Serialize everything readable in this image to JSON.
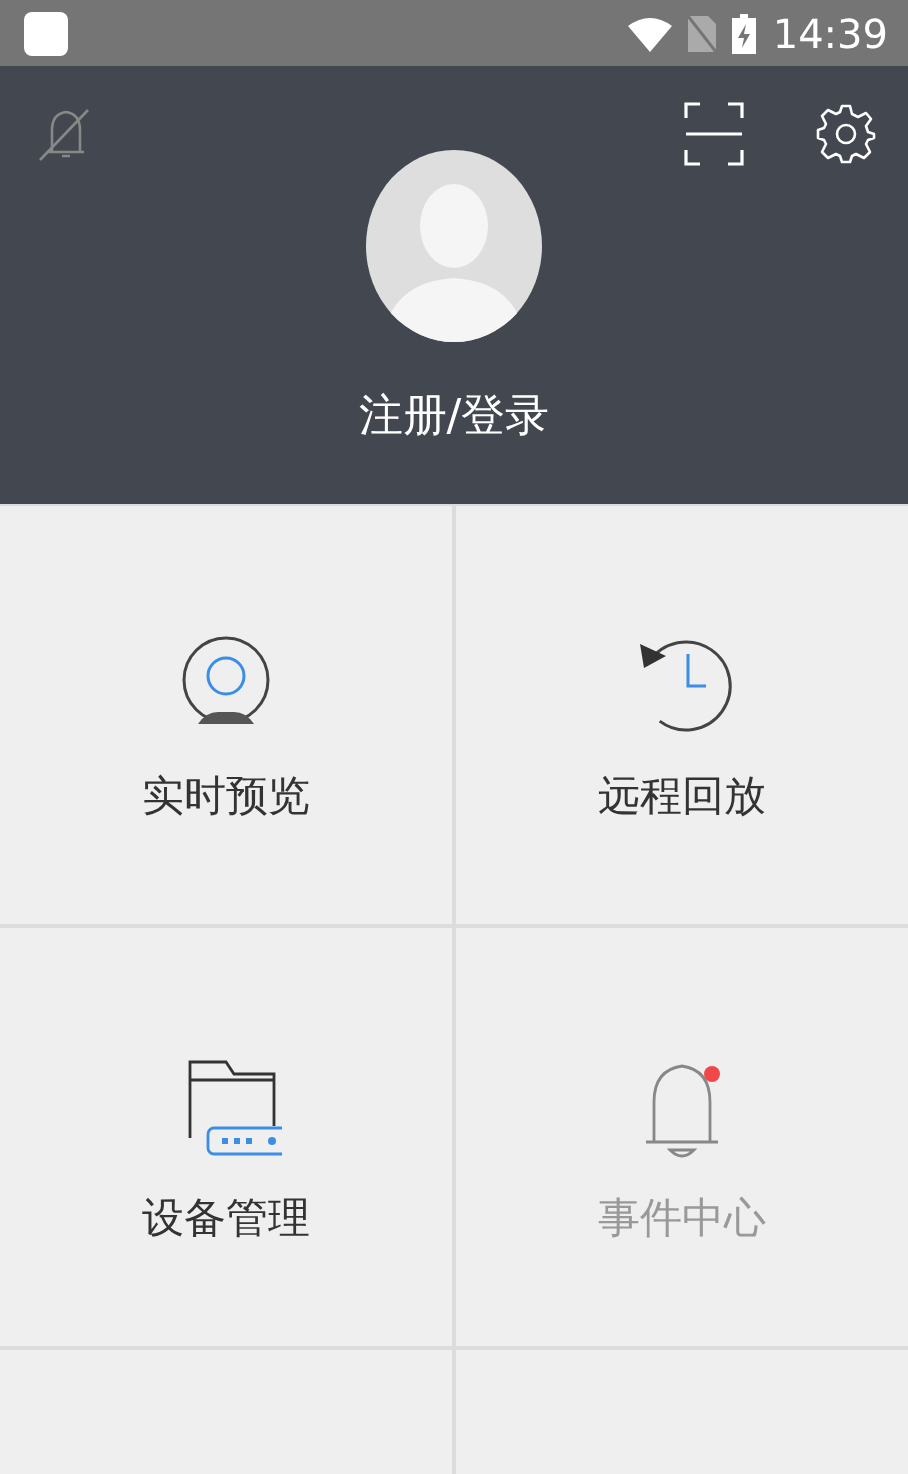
{
  "status_bar": {
    "time": "14:39"
  },
  "header": {
    "login_label": "注册/登录"
  },
  "menu": [
    {
      "kind": "camera",
      "label": "实时预览",
      "disabled": false
    },
    {
      "kind": "playback",
      "label": "远程回放",
      "disabled": false
    },
    {
      "kind": "devices",
      "label": "设备管理",
      "disabled": false
    },
    {
      "kind": "events",
      "label": "事件中心",
      "disabled": true,
      "badge": true
    }
  ]
}
